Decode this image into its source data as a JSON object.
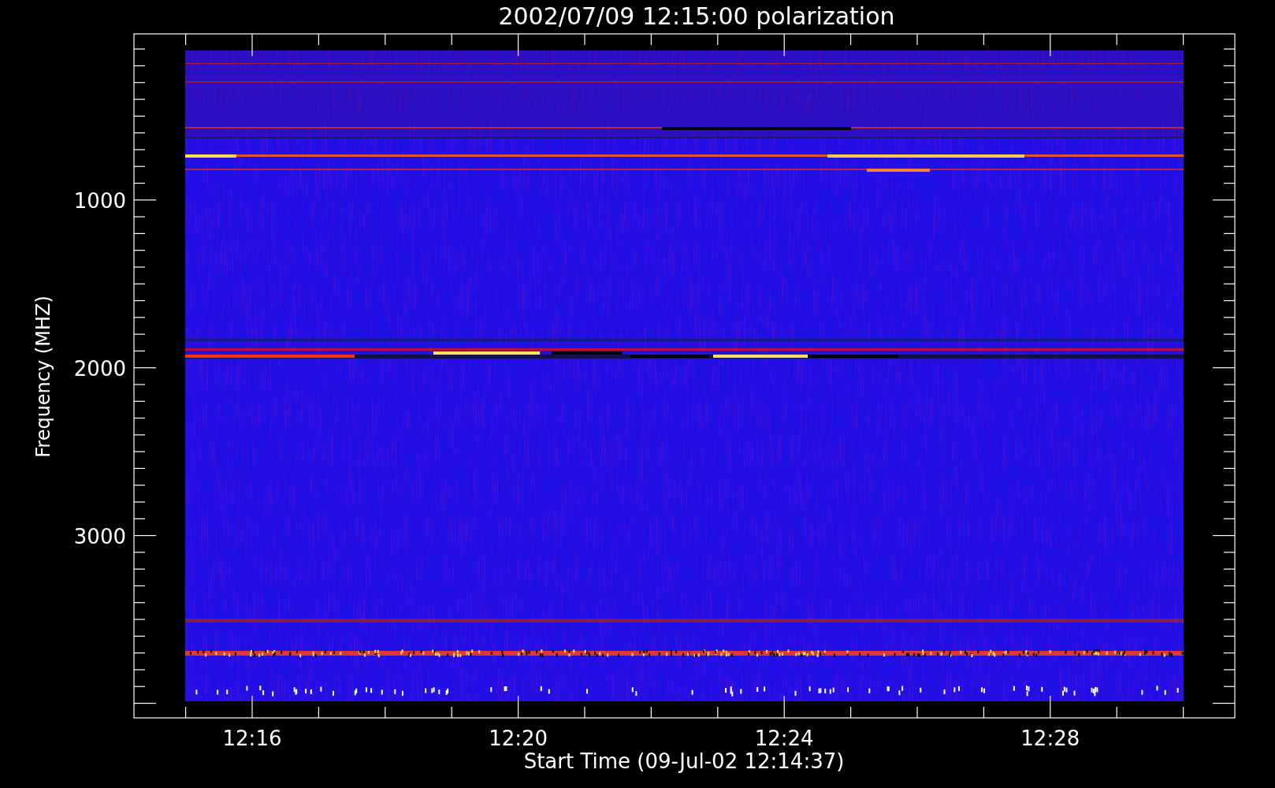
{
  "title": "2002/07/09 12:15:00 polarization",
  "ylabel": "Frequency (MHZ)",
  "yticks": [
    "1000",
    "2000",
    "3000"
  ],
  "xticks": [
    "12:16",
    "12:20",
    "12:24",
    "12:28"
  ],
  "xlabel": "Start Time (09-Jul-02 12:14:37)"
}
